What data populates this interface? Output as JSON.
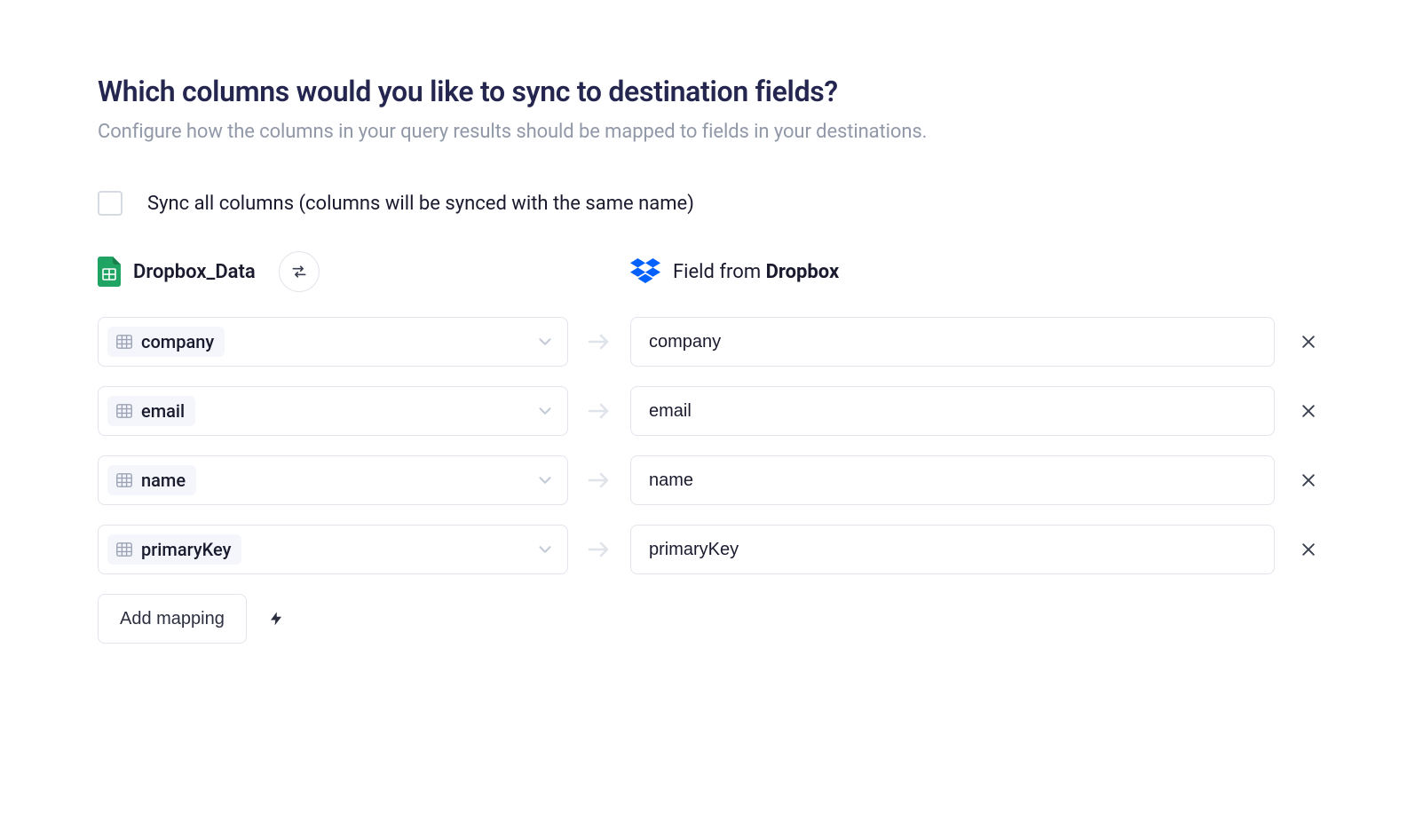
{
  "title": "Which columns would you like to sync to destination fields?",
  "subtitle": "Configure how the columns in your query results should be mapped to fields in your destinations.",
  "sync_all": {
    "checked": false,
    "label": "Sync all columns (columns will be synced with the same name)"
  },
  "source": {
    "icon": "google-sheets",
    "name": "Dropbox_Data"
  },
  "destination": {
    "icon": "dropbox",
    "label_prefix": "Field from ",
    "label_bold": "Dropbox"
  },
  "mappings": [
    {
      "source_column": "company",
      "dest_field": "company"
    },
    {
      "source_column": "email",
      "dest_field": "email"
    },
    {
      "source_column": "name",
      "dest_field": "name"
    },
    {
      "source_column": "primaryKey",
      "dest_field": "primaryKey"
    }
  ],
  "footer": {
    "add_mapping_label": "Add mapping"
  }
}
